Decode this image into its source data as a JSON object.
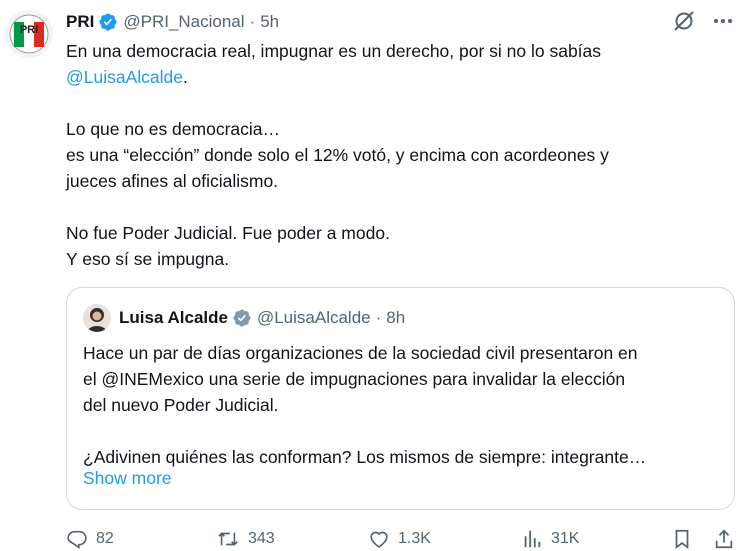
{
  "tweet": {
    "display_name": "PRI",
    "handle": "@PRI_Nacional",
    "separator": "·",
    "time": "5h",
    "avatar_logo_text": "PRI",
    "lines": [
      {
        "text": "En una democracia real, impugnar es un derecho, por si no lo sabías"
      },
      {
        "mention": "@LuisaAlcalde",
        "after": "."
      },
      {
        "text": ""
      },
      {
        "text": "Lo que no es democracia…"
      },
      {
        "text": "es una “elección” donde solo el 12% votó, y encima con acordeones y"
      },
      {
        "text": "jueces afines al oficialismo."
      },
      {
        "text": ""
      },
      {
        "text": "No fue Poder Judicial. Fue poder a modo."
      },
      {
        "text": "Y eso sí se impugna."
      }
    ]
  },
  "quote": {
    "display_name": "Luisa Alcalde",
    "handle": "@LuisaAlcalde",
    "separator": "·",
    "time": "8h",
    "lines": [
      "Hace un par de días organizaciones de la sociedad civil presentaron en",
      "el @INEMexico una serie de impugnaciones para invalidar la elección",
      "del nuevo Poder Judicial.",
      "",
      "¿Adivinen quiénes las conforman? Los mismos de siempre: integrante…"
    ],
    "show_more": "Show more"
  },
  "actions": {
    "replies": "82",
    "reposts": "343",
    "likes": "1.3K",
    "views": "31K"
  },
  "colors": {
    "accent": "#1d9bf0",
    "muted": "#536471",
    "border": "#cfd9de",
    "verified_gold_gray": "#829aab",
    "pri_green": "#009a44",
    "pri_red": "#e1261c"
  }
}
